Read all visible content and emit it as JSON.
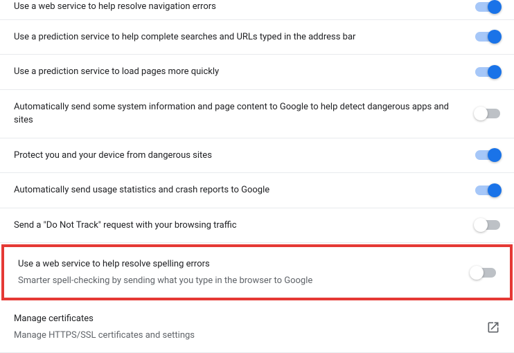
{
  "settings": {
    "items": [
      {
        "title": "Use a web service to help resolve navigation errors",
        "subtitle": "",
        "state": "on",
        "control": "toggle"
      },
      {
        "title": "Use a prediction service to help complete searches and URLs typed in the address bar",
        "subtitle": "",
        "state": "on",
        "control": "toggle"
      },
      {
        "title": "Use a prediction service to load pages more quickly",
        "subtitle": "",
        "state": "on",
        "control": "toggle"
      },
      {
        "title": "Automatically send some system information and page content to Google to help detect dangerous apps and sites",
        "subtitle": "",
        "state": "off",
        "control": "toggle"
      },
      {
        "title": "Protect you and your device from dangerous sites",
        "subtitle": "",
        "state": "on",
        "control": "toggle"
      },
      {
        "title": "Automatically send usage statistics and crash reports to Google",
        "subtitle": "",
        "state": "on",
        "control": "toggle"
      },
      {
        "title": "Send a \"Do Not Track\" request with your browsing traffic",
        "subtitle": "",
        "state": "off",
        "control": "toggle"
      },
      {
        "title": "Use a web service to help resolve spelling errors",
        "subtitle": "Smarter spell-checking by sending what you type in the browser to Google",
        "state": "off",
        "control": "toggle",
        "highlight": true
      },
      {
        "title": "Manage certificates",
        "subtitle": "Manage HTTPS/SSL certificates and settings",
        "state": "",
        "control": "external"
      }
    ]
  }
}
